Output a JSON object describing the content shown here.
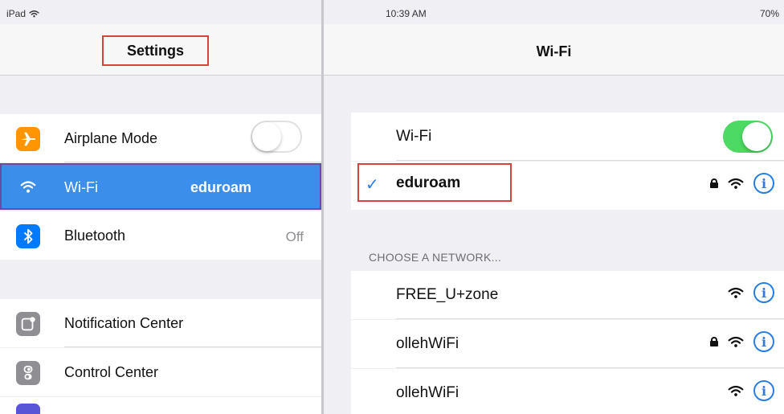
{
  "status_bar": {
    "device": "iPad",
    "time": "10:39 AM",
    "battery": "70%"
  },
  "sidebar": {
    "title": "Settings",
    "items": [
      {
        "label": "Airplane Mode",
        "icon": "airplane-icon",
        "icon_color": "#ff9500",
        "toggle": false
      },
      {
        "label": "Wi-Fi",
        "value": "eduroam",
        "icon": "wifi-icon",
        "icon_color": "#3b8eea",
        "selected": true
      },
      {
        "label": "Bluetooth",
        "value": "Off",
        "icon": "bluetooth-icon",
        "icon_color": "#007aff"
      },
      {
        "label": "Notification Center",
        "icon": "notification-center-icon",
        "icon_color": "#8e8e93"
      },
      {
        "label": "Control Center",
        "icon": "control-center-icon",
        "icon_color": "#8e8e93"
      }
    ]
  },
  "detail": {
    "title": "Wi-Fi",
    "wifi_label": "Wi-Fi",
    "wifi_enabled": true,
    "connected_network": "eduroam",
    "section_header": "CHOOSE A NETWORK...",
    "networks": [
      {
        "name": "FREE_U+zone",
        "locked": false
      },
      {
        "name": "ollehWiFi",
        "locked": true
      },
      {
        "name": "ollehWiFi",
        "locked": false
      }
    ]
  },
  "colors": {
    "accent": "#2a7de1",
    "selection": "#3b8eea",
    "toggle_on": "#4cd964",
    "highlight_box": "#d6443e"
  }
}
